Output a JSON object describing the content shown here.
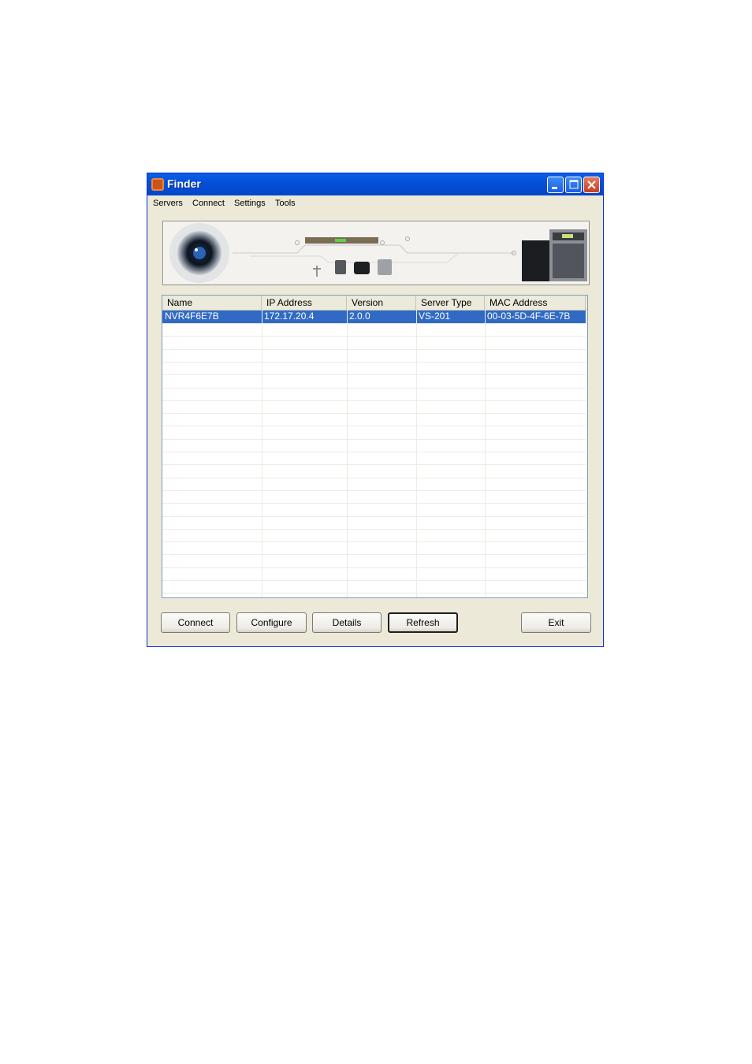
{
  "window": {
    "title": "Finder"
  },
  "menu": [
    "Servers",
    "Connect",
    "Settings",
    "Tools"
  ],
  "table": {
    "columns": [
      "Name",
      "IP Address",
      "Version",
      "Server Type",
      "MAC Address"
    ],
    "rows": [
      [
        "NVR4F6E7B",
        "172.17.20.4",
        "2.0.0",
        "VS-201",
        "00-03-5D-4F-6E-7B"
      ]
    ],
    "selected_row": 0
  },
  "buttons": {
    "connect": "Connect",
    "configure": "Configure",
    "details": "Details",
    "refresh": "Refresh",
    "exit": "Exit"
  },
  "colors": {
    "titlebar": "#0550d8",
    "selection": "#316ac5",
    "dialog": "#ece9d8"
  },
  "icons": {
    "app": "finder-app-icon",
    "minimize": "minimize-icon",
    "maximize": "maximize-icon",
    "close": "close-icon"
  }
}
